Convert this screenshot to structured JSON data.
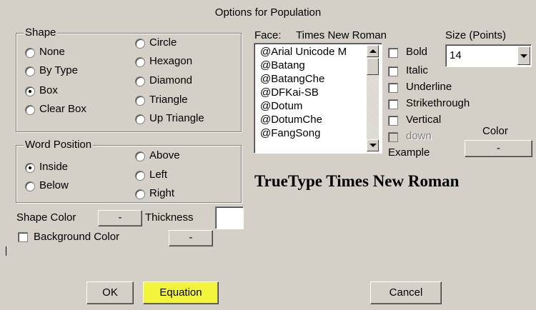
{
  "dialog": {
    "title": "Options for Population"
  },
  "shape": {
    "legend": "Shape",
    "options": [
      "None",
      "By Type",
      "Box",
      "Clear Box",
      "Circle",
      "Hexagon",
      "Diamond",
      "Triangle",
      "Up Triangle"
    ],
    "selected": "Box"
  },
  "word_position": {
    "legend": "Word Position",
    "options": [
      "Inside",
      "Below",
      "Above",
      "Left",
      "Right"
    ],
    "selected": "Inside"
  },
  "shape_color": {
    "label": "Shape Color",
    "button": "-"
  },
  "thickness": {
    "label": "Thickness",
    "value": ""
  },
  "background_color": {
    "label": "Background Color",
    "button": "-",
    "checked": false
  },
  "font": {
    "face_label": "Face:",
    "face_value": "Times New Roman",
    "size_label": "Size (Points)",
    "size_value": "14",
    "list": [
      "@Arial Unicode M",
      "@Batang",
      "@BatangChe",
      "@DFKai-SB",
      "@Dotum",
      "@DotumChe",
      "@FangSong"
    ],
    "styles": [
      "Bold",
      "Italic",
      "Underline",
      "Strikethrough",
      "Vertical",
      "down"
    ],
    "color_label": "Color",
    "color_button": "-",
    "example_label": "Example",
    "example_text": "TrueType Times New Roman"
  },
  "buttons": {
    "ok": "OK",
    "equation": "Equation",
    "cancel": "Cancel"
  },
  "colors": {
    "dialog_bg": "#d4d0c8",
    "highlight": "#f3f53a"
  }
}
